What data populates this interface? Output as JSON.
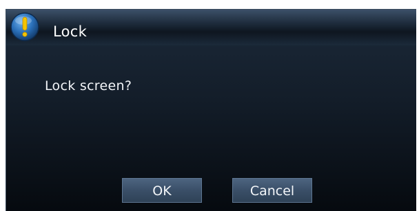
{
  "dialog": {
    "title": "Lock",
    "message": "Lock screen?",
    "icon": "warning-exclamation-icon",
    "buttons": {
      "ok_label": "OK",
      "cancel_label": "Cancel"
    }
  },
  "colors": {
    "icon_fill": "#2a6fb8",
    "icon_mark": "#f5c400",
    "text": "#ffffff"
  }
}
